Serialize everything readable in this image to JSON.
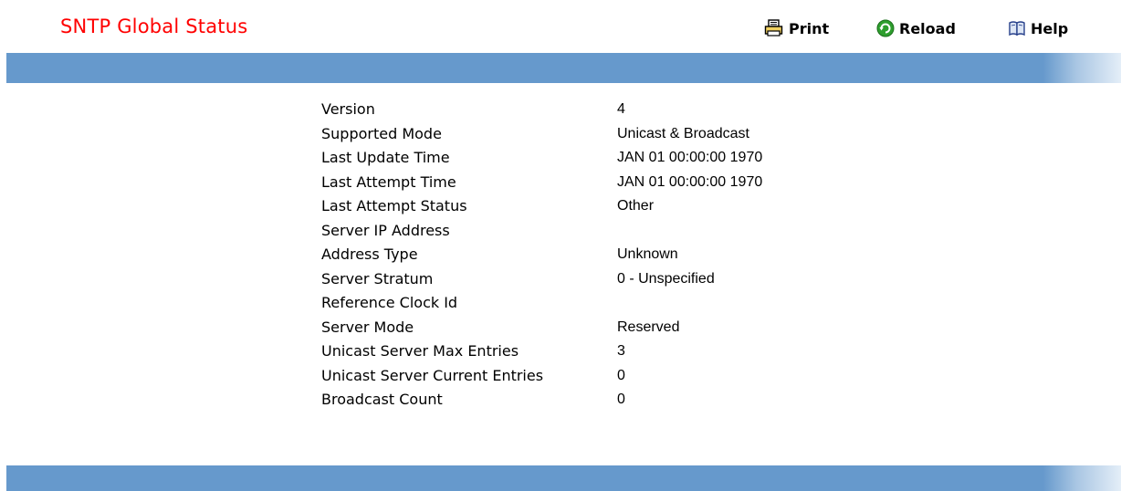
{
  "header": {
    "title": "SNTP Global Status",
    "print_label": "Print",
    "reload_label": "Reload",
    "help_label": "Help"
  },
  "icons": {
    "print": "printer-icon",
    "reload": "reload-icon",
    "help": "help-book-icon"
  },
  "colors": {
    "title": "#ff0000",
    "bar": "#6699cc",
    "reload_icon": "#2e9e2e"
  },
  "status": {
    "rows": [
      {
        "label": "Version",
        "value": "4"
      },
      {
        "label": "Supported Mode",
        "value": "Unicast & Broadcast"
      },
      {
        "label": "Last Update Time",
        "value": "JAN 01 00:00:00 1970"
      },
      {
        "label": "Last Attempt Time",
        "value": "JAN 01 00:00:00 1970"
      },
      {
        "label": "Last Attempt Status",
        "value": "Other"
      },
      {
        "label": "Server IP Address",
        "value": ""
      },
      {
        "label": "Address Type",
        "value": "Unknown"
      },
      {
        "label": "Server Stratum",
        "value": "0 - Unspecified"
      },
      {
        "label": "Reference Clock Id",
        "value": ""
      },
      {
        "label": "Server Mode",
        "value": "Reserved"
      },
      {
        "label": "Unicast Server Max Entries",
        "value": "3"
      },
      {
        "label": "Unicast Server Current Entries",
        "value": "0"
      },
      {
        "label": "Broadcast Count",
        "value": "0"
      }
    ]
  }
}
